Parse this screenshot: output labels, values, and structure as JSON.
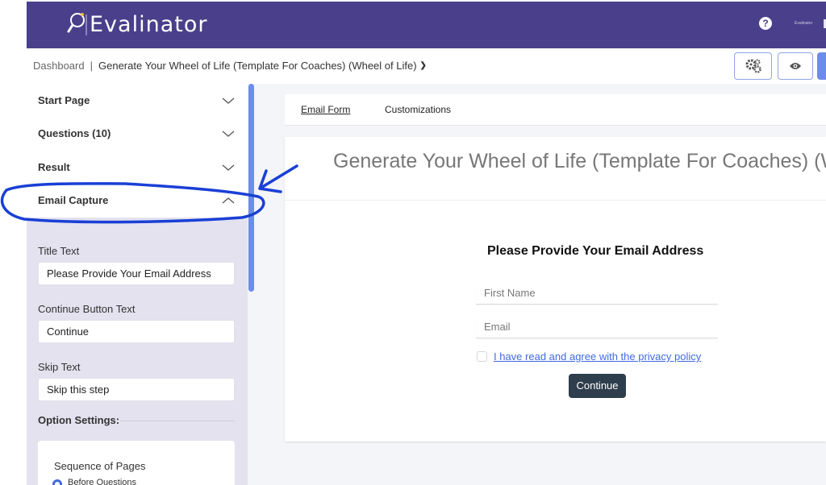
{
  "app": {
    "name": "Evalinator",
    "user_label": "Evalinator"
  },
  "breadcrumb": {
    "root": "Dashboard",
    "separator": "|",
    "current": "Generate Your Wheel of Life (Template For Coaches) (Wheel of Life)"
  },
  "toolbar": {
    "settings_icon": "gears-icon",
    "preview_icon": "eye-icon",
    "help_icon": "question-circle-icon"
  },
  "sidebar": {
    "sections": [
      {
        "label": "Start Page",
        "expanded": false
      },
      {
        "label": "Questions (10)",
        "expanded": false
      },
      {
        "label": "Result",
        "expanded": false
      },
      {
        "label": "Email Capture",
        "expanded": true
      }
    ],
    "email_capture": {
      "title_text_label": "Title Text",
      "title_text_value": "Please Provide Your Email Address",
      "continue_label": "Continue Button Text",
      "continue_value": "Continue",
      "skip_label": "Skip Text",
      "skip_value": "Skip this step",
      "option_settings_label": "Option Settings:",
      "sequence_label": "Sequence of Pages",
      "sequence_option_selected": "Before Questions"
    }
  },
  "tabs": [
    {
      "label": "Email Form",
      "active": true
    },
    {
      "label": "Customizations",
      "active": false
    }
  ],
  "preview": {
    "title": "Generate Your Wheel of Life (Template For Coaches) (Wheel of Life)",
    "form_title": "Please Provide Your Email Address",
    "first_name_placeholder": "First Name",
    "email_placeholder": "Email",
    "privacy_text": "I have read and agree with the privacy policy",
    "privacy_checked": false,
    "continue_label": "Continue"
  },
  "colors": {
    "topbar": "#4a3f8a",
    "accent": "#6b8cf0",
    "button_dark": "#2f3e4c",
    "annotation": "#1a3fd6"
  }
}
